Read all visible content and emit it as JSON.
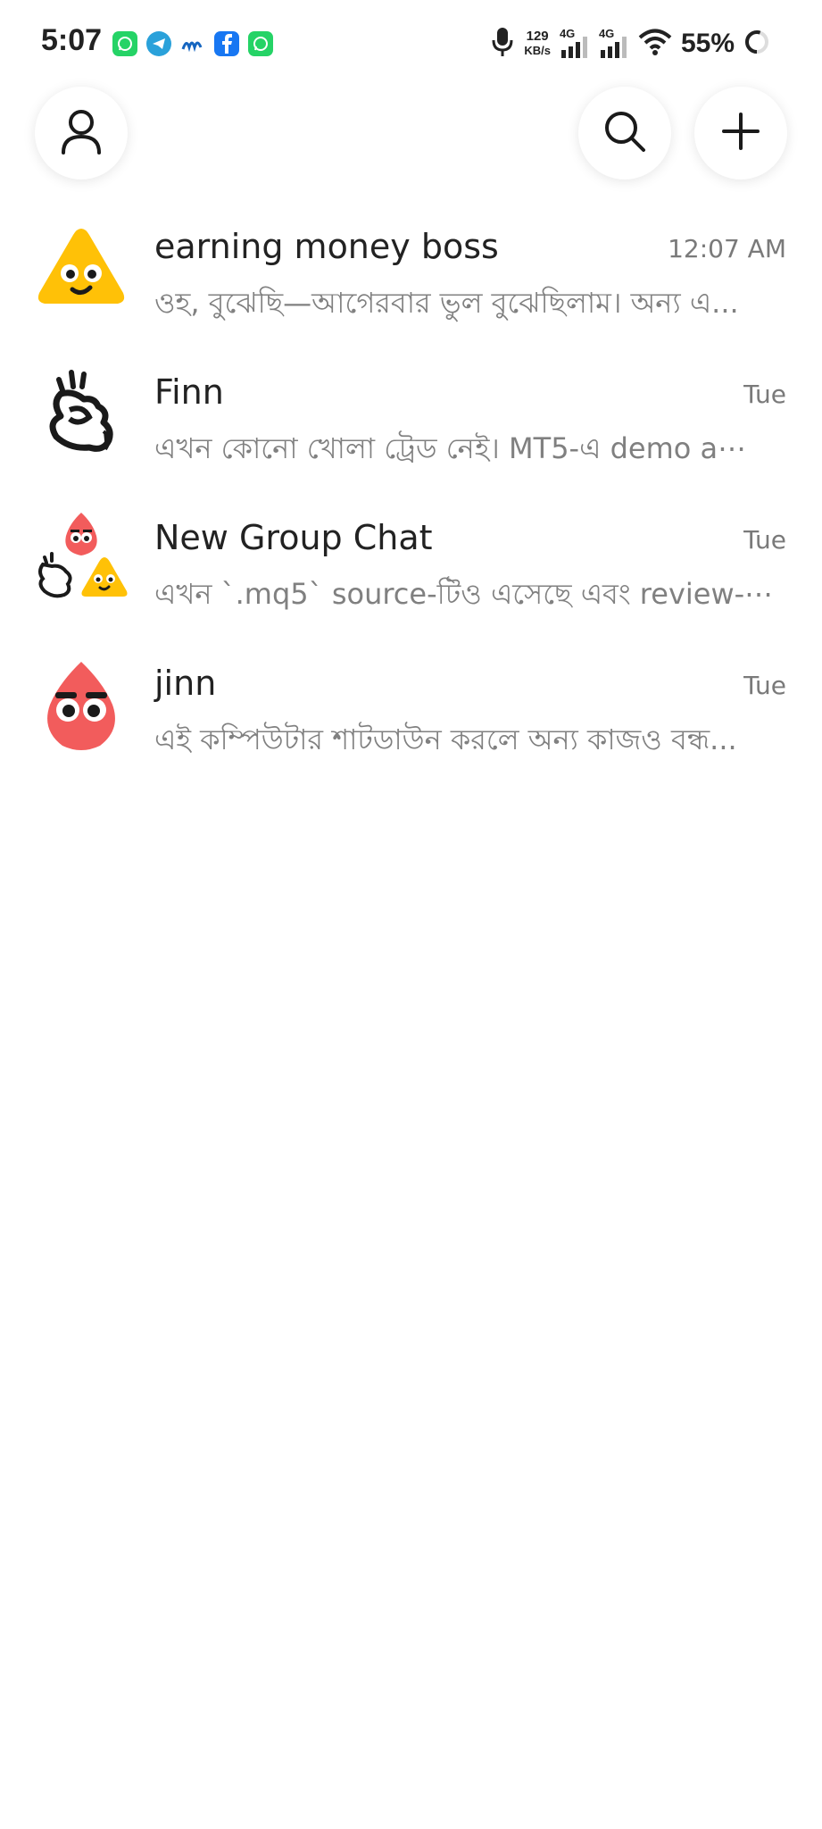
{
  "status_bar": {
    "time": "5:07",
    "net_speed_value": "129",
    "net_speed_unit": "KB/s",
    "network_type_1": "4G",
    "network_type_2": "4G",
    "battery_percent": "55%",
    "notification_apps": [
      "whatsapp-icon",
      "telegram-icon",
      "messenger-m-icon",
      "facebook-icon",
      "whatsapp-icon"
    ]
  },
  "header": {
    "profile_icon": "person-icon",
    "search_icon": "search-icon",
    "add_icon": "plus-icon"
  },
  "chats": [
    {
      "name": "earning money boss",
      "time": "12:07 AM",
      "preview": "ওহ, বুঝেছি—আগেরবার ভুল বুঝেছিলাম। অন্য এ..."
    },
    {
      "name": "Finn",
      "time": "Tue",
      "preview": "এখন কোনো খোলা ট্রেড নেই। MT5-এ demo a⋯"
    },
    {
      "name": "New Group Chat",
      "time": "Tue",
      "preview": "এখন `.mq5` source-টিও এসেছে এবং review-⋯"
    },
    {
      "name": "jinn",
      "time": "Tue",
      "preview": "এই কম্পিউটার শাটডাউন করলে অন্য কাজও বন্ধ..."
    }
  ],
  "colors": {
    "yellow_avatar": "#FFC107",
    "red_avatar": "#F25C5C",
    "whatsapp": "#25D366",
    "telegram": "#2AA1DA",
    "facebook": "#1877F2"
  }
}
